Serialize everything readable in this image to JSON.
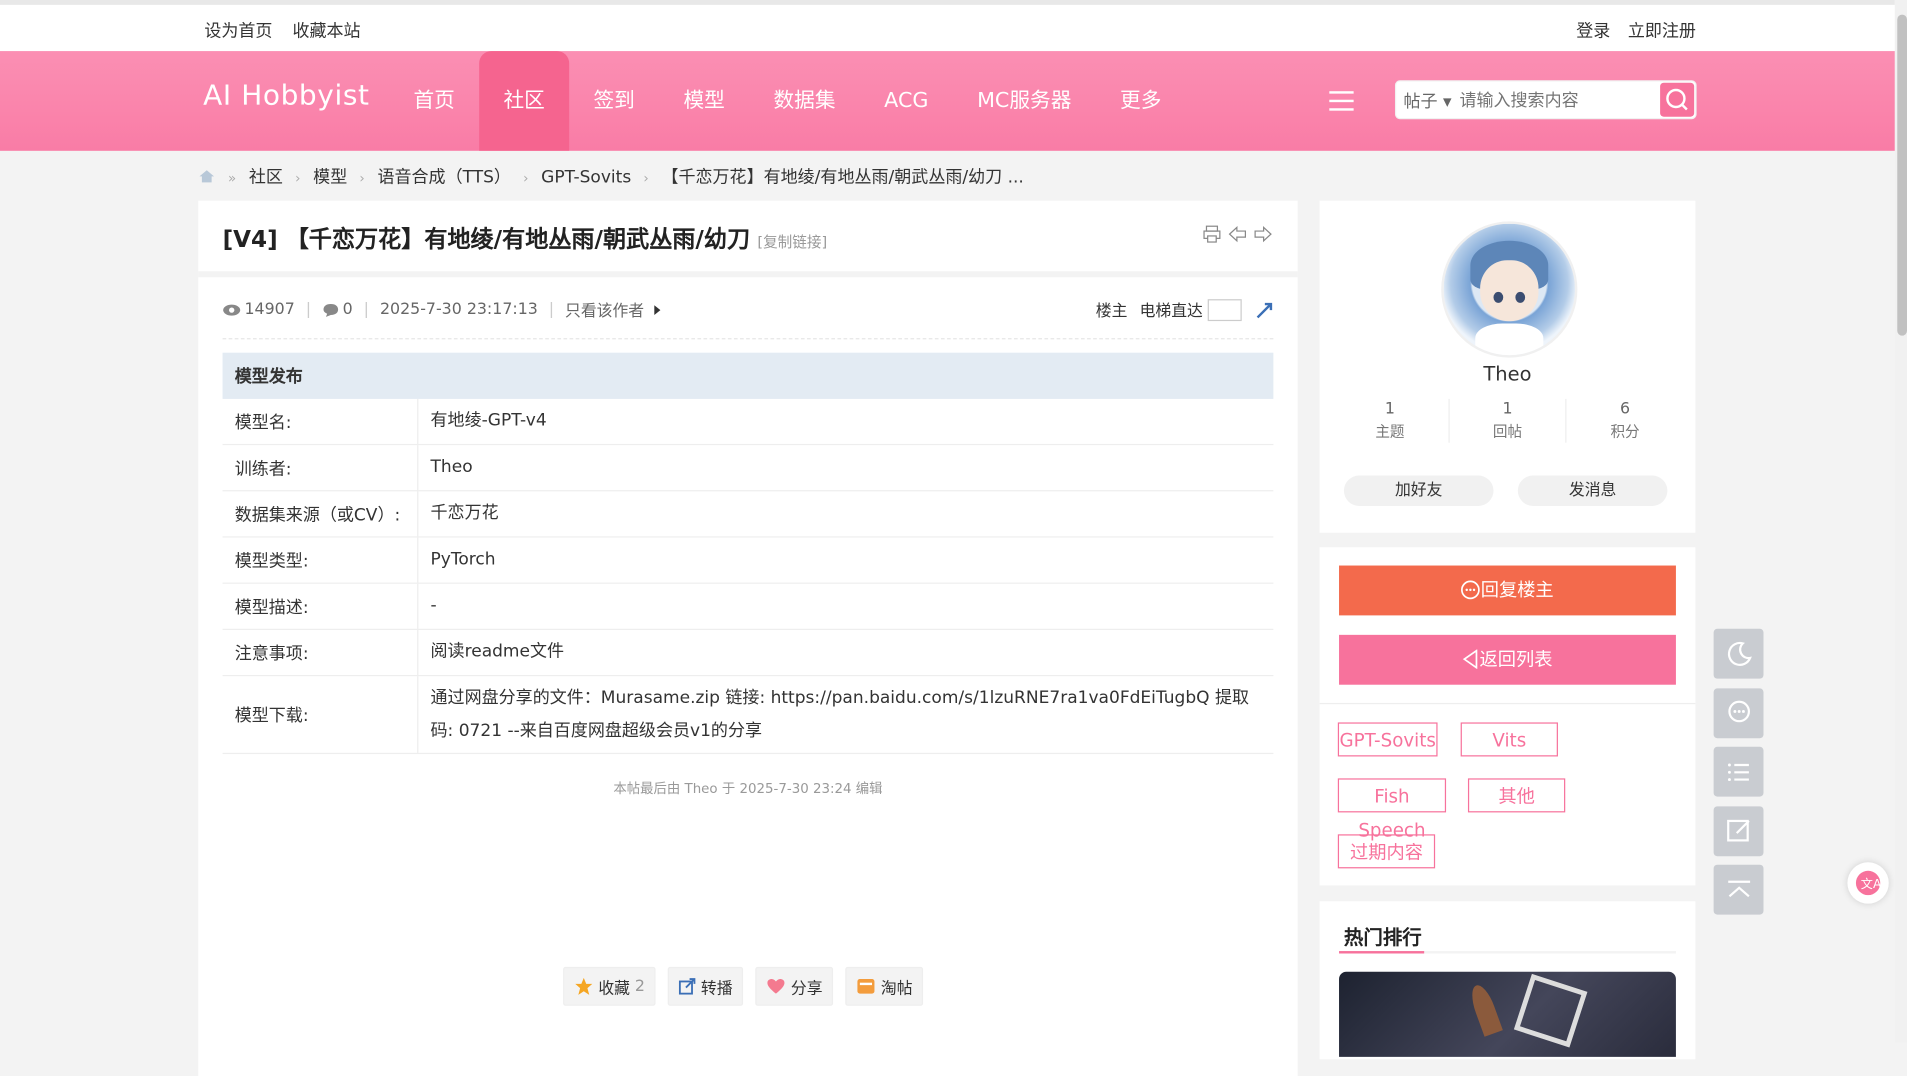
{
  "topbar": {
    "set_home": "设为首页",
    "bookmark": "收藏本站",
    "login": "登录",
    "register": "立即注册"
  },
  "header": {
    "logo": "AI Hobbyist",
    "nav": [
      "首页",
      "社区",
      "签到",
      "模型",
      "数据集",
      "ACG",
      "MC服务器",
      "更多"
    ],
    "active_nav": "社区",
    "search_type": "帖子",
    "search_placeholder": "请输入搜索内容"
  },
  "breadcrumb": [
    "社区",
    "模型",
    "语音合成（TTS）",
    "GPT-Sovits",
    "【千恋万花】有地绫/有地丛雨/朝武丛雨/幼刀 ..."
  ],
  "post": {
    "title": "[V4] 【千恋万花】有地绫/有地丛雨/朝武丛雨/幼刀",
    "copy_link": "[复制链接]",
    "views": "14907",
    "replies": "0",
    "datetime": "2025-7-30 23:17:13",
    "only_author": "只看该作者",
    "floor_label": "楼主",
    "elevator_label": "电梯直达",
    "table_header": "模型发布",
    "rows": [
      {
        "key": "模型名:",
        "value": "有地绫-GPT-v4"
      },
      {
        "key": "训练者:",
        "value": "Theo"
      },
      {
        "key": "数据集来源（或CV）:",
        "value": "千恋万花"
      },
      {
        "key": "模型类型:",
        "value": "PyTorch"
      },
      {
        "key": "模型描述:",
        "value": "-"
      },
      {
        "key": "注意事项:",
        "value": "阅读readme文件"
      },
      {
        "key": "模型下载:",
        "value": "通过网盘分享的文件：Murasame.zip 链接: https://pan.baidu.com/s/1lzuRNE7ra1va0FdEiTugbQ 提取码: 0721 --来自百度网盘超级会员v1的分享"
      }
    ],
    "edit_note": "本帖最后由 Theo 于 2025-7-30 23:24 编辑",
    "actions": {
      "favorite": "收藏",
      "favorite_count": "2",
      "repost": "转播",
      "share": "分享",
      "taobao": "淘帖"
    }
  },
  "profile": {
    "username": "Theo",
    "stats": [
      {
        "value": "1",
        "label": "主题"
      },
      {
        "value": "1",
        "label": "回帖"
      },
      {
        "value": "6",
        "label": "积分"
      }
    ],
    "add_friend": "加好友",
    "send_message": "发消息"
  },
  "reply": {
    "reply_button": "回复楼主",
    "back_button": "返回列表",
    "tags": [
      "GPT-Sovits",
      "Vits",
      "Fish Speech",
      "其他",
      "过期内容"
    ]
  },
  "hot": {
    "title": "热门排行"
  },
  "colors": {
    "brand_pink": "#f7729c",
    "reply_orange": "#f36a4c",
    "header_gradient": "#fb8fb3"
  }
}
